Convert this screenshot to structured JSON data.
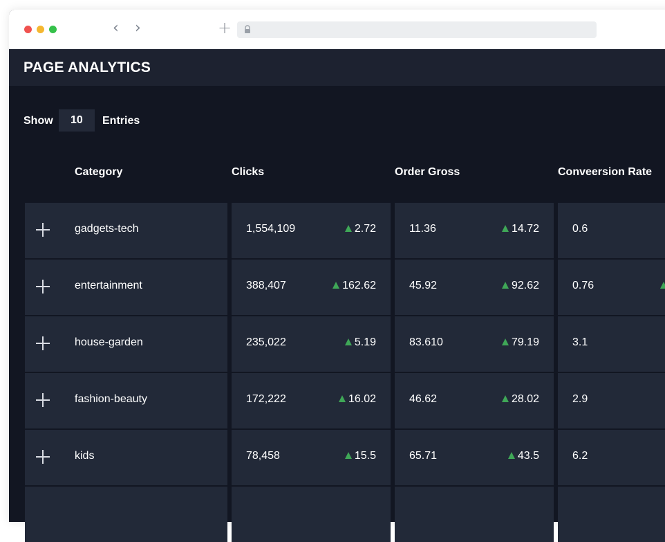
{
  "header": {
    "title": "PAGE ANALYTICS"
  },
  "controls": {
    "show_label": "Show",
    "entries_value": "10",
    "entries_label": "Entries"
  },
  "columns": [
    "Category",
    "Clicks",
    "Order Gross",
    "Conveersion Rate"
  ],
  "rows": [
    {
      "category": "gadgets-tech",
      "clicks": "1,554,109",
      "clicks_delta": "2.72",
      "gross": "11.36",
      "gross_delta": "14.72",
      "rate": "0.6"
    },
    {
      "category": "entertainment",
      "clicks": "388,407",
      "clicks_delta": "162.62",
      "gross": "45.92",
      "gross_delta": "92.62",
      "rate": "0.76"
    },
    {
      "category": "house-garden",
      "clicks": "235,022",
      "clicks_delta": "5.19",
      "gross": "83.610",
      "gross_delta": "79.19",
      "rate": "3.1"
    },
    {
      "category": "fashion-beauty",
      "clicks": "172,222",
      "clicks_delta": "16.02",
      "gross": "46.62",
      "gross_delta": "28.02",
      "rate": "2.9"
    },
    {
      "category": "kids",
      "clicks": "78,458",
      "clicks_delta": "15.5",
      "gross": "65.71",
      "gross_delta": "43.5",
      "rate": "6.2"
    }
  ],
  "colors": {
    "bg": "#121622",
    "header": "#1d2230",
    "cell": "#222938",
    "up": "#3fa757"
  }
}
